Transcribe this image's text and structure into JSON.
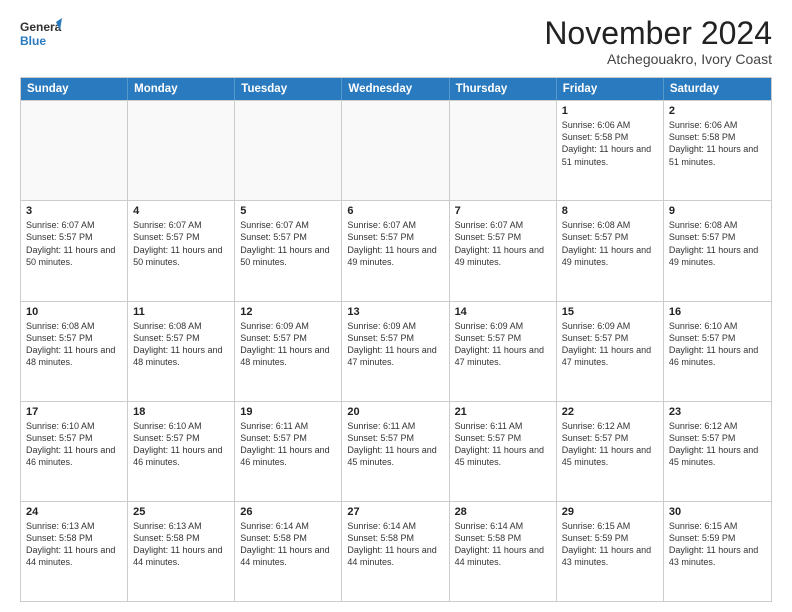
{
  "logo": {
    "line1": "General",
    "line2": "Blue"
  },
  "title": "November 2024",
  "location": "Atchegouakro, Ivory Coast",
  "headers": [
    "Sunday",
    "Monday",
    "Tuesday",
    "Wednesday",
    "Thursday",
    "Friday",
    "Saturday"
  ],
  "weeks": [
    [
      {
        "day": "",
        "info": ""
      },
      {
        "day": "",
        "info": ""
      },
      {
        "day": "",
        "info": ""
      },
      {
        "day": "",
        "info": ""
      },
      {
        "day": "",
        "info": ""
      },
      {
        "day": "1",
        "info": "Sunrise: 6:06 AM\nSunset: 5:58 PM\nDaylight: 11 hours and 51 minutes."
      },
      {
        "day": "2",
        "info": "Sunrise: 6:06 AM\nSunset: 5:58 PM\nDaylight: 11 hours and 51 minutes."
      }
    ],
    [
      {
        "day": "3",
        "info": "Sunrise: 6:07 AM\nSunset: 5:57 PM\nDaylight: 11 hours and 50 minutes."
      },
      {
        "day": "4",
        "info": "Sunrise: 6:07 AM\nSunset: 5:57 PM\nDaylight: 11 hours and 50 minutes."
      },
      {
        "day": "5",
        "info": "Sunrise: 6:07 AM\nSunset: 5:57 PM\nDaylight: 11 hours and 50 minutes."
      },
      {
        "day": "6",
        "info": "Sunrise: 6:07 AM\nSunset: 5:57 PM\nDaylight: 11 hours and 49 minutes."
      },
      {
        "day": "7",
        "info": "Sunrise: 6:07 AM\nSunset: 5:57 PM\nDaylight: 11 hours and 49 minutes."
      },
      {
        "day": "8",
        "info": "Sunrise: 6:08 AM\nSunset: 5:57 PM\nDaylight: 11 hours and 49 minutes."
      },
      {
        "day": "9",
        "info": "Sunrise: 6:08 AM\nSunset: 5:57 PM\nDaylight: 11 hours and 49 minutes."
      }
    ],
    [
      {
        "day": "10",
        "info": "Sunrise: 6:08 AM\nSunset: 5:57 PM\nDaylight: 11 hours and 48 minutes."
      },
      {
        "day": "11",
        "info": "Sunrise: 6:08 AM\nSunset: 5:57 PM\nDaylight: 11 hours and 48 minutes."
      },
      {
        "day": "12",
        "info": "Sunrise: 6:09 AM\nSunset: 5:57 PM\nDaylight: 11 hours and 48 minutes."
      },
      {
        "day": "13",
        "info": "Sunrise: 6:09 AM\nSunset: 5:57 PM\nDaylight: 11 hours and 47 minutes."
      },
      {
        "day": "14",
        "info": "Sunrise: 6:09 AM\nSunset: 5:57 PM\nDaylight: 11 hours and 47 minutes."
      },
      {
        "day": "15",
        "info": "Sunrise: 6:09 AM\nSunset: 5:57 PM\nDaylight: 11 hours and 47 minutes."
      },
      {
        "day": "16",
        "info": "Sunrise: 6:10 AM\nSunset: 5:57 PM\nDaylight: 11 hours and 46 minutes."
      }
    ],
    [
      {
        "day": "17",
        "info": "Sunrise: 6:10 AM\nSunset: 5:57 PM\nDaylight: 11 hours and 46 minutes."
      },
      {
        "day": "18",
        "info": "Sunrise: 6:10 AM\nSunset: 5:57 PM\nDaylight: 11 hours and 46 minutes."
      },
      {
        "day": "19",
        "info": "Sunrise: 6:11 AM\nSunset: 5:57 PM\nDaylight: 11 hours and 46 minutes."
      },
      {
        "day": "20",
        "info": "Sunrise: 6:11 AM\nSunset: 5:57 PM\nDaylight: 11 hours and 45 minutes."
      },
      {
        "day": "21",
        "info": "Sunrise: 6:11 AM\nSunset: 5:57 PM\nDaylight: 11 hours and 45 minutes."
      },
      {
        "day": "22",
        "info": "Sunrise: 6:12 AM\nSunset: 5:57 PM\nDaylight: 11 hours and 45 minutes."
      },
      {
        "day": "23",
        "info": "Sunrise: 6:12 AM\nSunset: 5:57 PM\nDaylight: 11 hours and 45 minutes."
      }
    ],
    [
      {
        "day": "24",
        "info": "Sunrise: 6:13 AM\nSunset: 5:58 PM\nDaylight: 11 hours and 44 minutes."
      },
      {
        "day": "25",
        "info": "Sunrise: 6:13 AM\nSunset: 5:58 PM\nDaylight: 11 hours and 44 minutes."
      },
      {
        "day": "26",
        "info": "Sunrise: 6:14 AM\nSunset: 5:58 PM\nDaylight: 11 hours and 44 minutes."
      },
      {
        "day": "27",
        "info": "Sunrise: 6:14 AM\nSunset: 5:58 PM\nDaylight: 11 hours and 44 minutes."
      },
      {
        "day": "28",
        "info": "Sunrise: 6:14 AM\nSunset: 5:58 PM\nDaylight: 11 hours and 44 minutes."
      },
      {
        "day": "29",
        "info": "Sunrise: 6:15 AM\nSunset: 5:59 PM\nDaylight: 11 hours and 43 minutes."
      },
      {
        "day": "30",
        "info": "Sunrise: 6:15 AM\nSunset: 5:59 PM\nDaylight: 11 hours and 43 minutes."
      }
    ]
  ]
}
